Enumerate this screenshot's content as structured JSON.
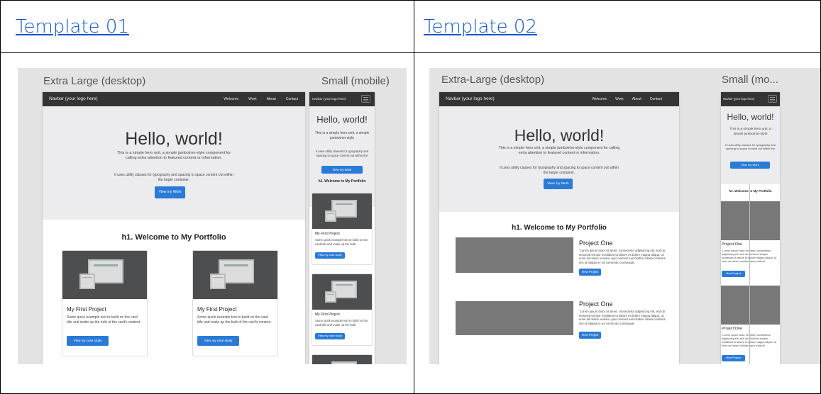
{
  "templates": [
    {
      "link": "Template 01"
    },
    {
      "link": "Template 02"
    }
  ],
  "t1": {
    "desktop_label": "Extra Large (desktop)",
    "mobile_label": "Small (mobile)",
    "nav_brand": "Navbar (your logo here)",
    "nav_links": [
      "Welcome",
      "Work",
      "About",
      "Contact"
    ],
    "hero_title": "Hello, world!",
    "hero_text": "This is a simple hero unit, a simple jumbotron-style component for calling extra attention to featured content or information.",
    "mobile_hero_text": "This is a simple hero unit, a simple jumbotron-style",
    "hero_sub": "It uses utility classes for typography and spacing to space content out within the larger container.",
    "mobile_hero_sub": "It uses utility classes for typography and spacing to space content out within the",
    "hero_btn": "View my Work",
    "section_title": "h1. Welcome to My Portfolio",
    "card_title": "My First Project",
    "card_text": "Some quick example text to build on the card title and make up the bulk of the card's content.",
    "mobile_card_text": "Some quick example text to build on the card title and make up the bulk.",
    "card_btn": "View my case study"
  },
  "t2": {
    "desktop_label": "Extra-Large (desktop)",
    "mobile_label": "Small (mo...",
    "nav_brand": "Navbar (your logo here)",
    "nav_links": [
      "Welcome",
      "Work",
      "About",
      "Contact"
    ],
    "hero_title": "Hello, world!",
    "hero_text": "This is a simple hero unit, a simple jumbotron-style component for calling extra attention to featured content or information.",
    "mobile_hero_text": "This is a simple hero unit, a simple jumbotron-style",
    "hero_sub": "It uses utility classes for typography and spacing to space content out within the larger container.",
    "mobile_hero_sub": "It uses utility classes for typography and spacing to space content out within the",
    "hero_btn": "View my Work",
    "section_title": "h1. Welcome to My Portfolio",
    "project_title": "Project One",
    "project_text": "\"Lorem ipsum dolor sit amet, consectetur adipisicing elit, sed do eiusmod tempor incididunt ut labore et dolore magna aliqua. Ut enim ad minim veniam, quis nostrud exercitation ullamco laboris nisi ut aliquip ex ea commodo consequat.",
    "mobile_project_text": "\"Lorem ipsum dolor sit amet, consectetur adipisicing elit, sed do eiusmod tempor incididunt ut labore et dolore magna aliqua. Ut enim ad minim veniam, quis nostrud.",
    "project_btn": "View Project"
  }
}
